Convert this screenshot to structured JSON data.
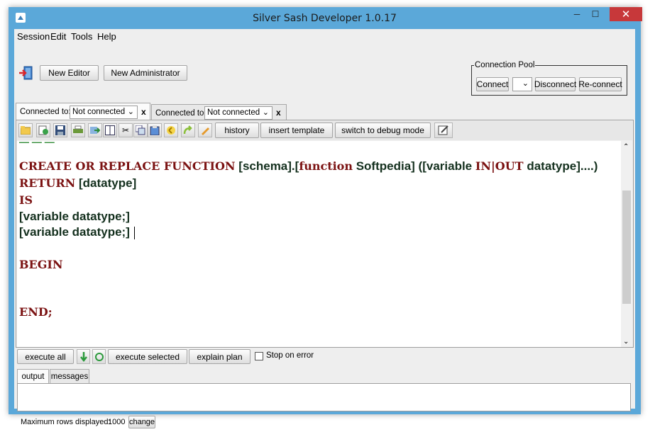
{
  "window": {
    "title": "Silver Sash Developer 1.0.17",
    "minimize_glyph": "─",
    "maximize_glyph": "☐",
    "close_glyph": "✕"
  },
  "menu": [
    "Session",
    "Edit",
    "Tools",
    "Help"
  ],
  "topbar": {
    "new_editor": "New Editor",
    "new_administrator": "New Administrator"
  },
  "connection_pool": {
    "legend": "Connection Pool",
    "connect": "Connect",
    "disconnect": "Disconnect",
    "reconnect": "Re-connect",
    "selected": ""
  },
  "tabs": [
    {
      "label": "Connected to:",
      "connection": "Not connected",
      "close": "x"
    },
    {
      "label": "Connected to:",
      "connection": "Not connected",
      "close": "x"
    }
  ],
  "editor_toolbar": {
    "history": "history",
    "insert_template": "insert template",
    "switch_debug": "switch to debug mode"
  },
  "editor": {
    "lines": [
      {
        "kw": "CREATE OR REPLACE FUNCTION",
        "text1": " [schema].[",
        "kw2": "function",
        "text2": " Softpedia] ([variable ",
        "kw3": "IN|OUT",
        "text3": " datatype]....)"
      },
      {
        "kw": "RETURN",
        "text1": " [datatype]"
      },
      {
        "kw": "IS"
      },
      {
        "text1": "[variable datatype;]"
      },
      {
        "text1": "[variable datatype;]"
      },
      {
        "kw": "BEGIN"
      },
      {
        "kw": "END;"
      }
    ]
  },
  "run_bar": {
    "execute_all": "execute all",
    "execute_selected": "execute selected",
    "explain_plan": "explain plan",
    "stop_on_error": "Stop on error",
    "stop_on_error_checked": false
  },
  "output": {
    "tabs": [
      "output",
      "messages"
    ],
    "active_tab": "output"
  },
  "status": {
    "max_rows_label": "Maximum rows displayed:",
    "max_rows_value": "1000",
    "change": "change"
  },
  "colors": {
    "titlebar": "#5ba8d9",
    "close_button": "#c7383a",
    "keyword": "#7b1212",
    "code_text": "#14301e"
  }
}
